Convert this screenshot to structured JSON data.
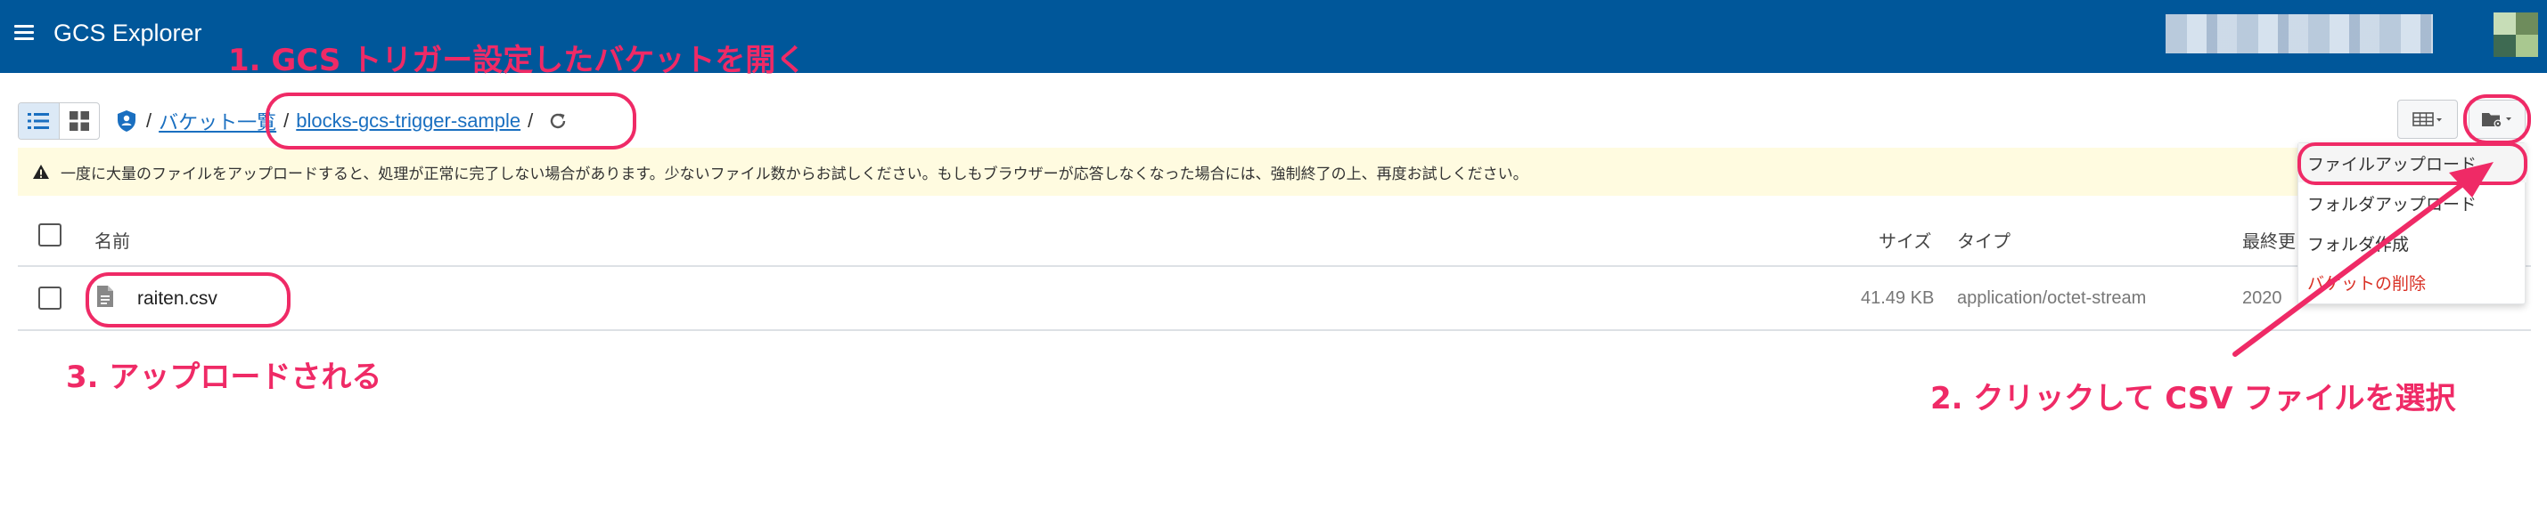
{
  "header": {
    "app_title": "GCS Explorer"
  },
  "breadcrumb": {
    "sep1": "/",
    "bucket_list": "バケット一覧",
    "sep2": "/",
    "bucket": "blocks-gcs-trigger-sample",
    "sep3": "/"
  },
  "warning": {
    "text": "一度に大量のファイルをアップロードすると、処理が正常に完了しない場合があります。少ないファイル数からお試しください。もしもブラウザーが応答しなくなった場合には、強制終了の上、再度お試しください。"
  },
  "table": {
    "columns": {
      "name": "名前",
      "size": "サイズ",
      "type": "タイプ",
      "modified": "最終更"
    },
    "rows": [
      {
        "name": "raiten.csv",
        "size": "41.49 KB",
        "type": "application/octet-stream",
        "modified": "2020"
      }
    ]
  },
  "menu": {
    "items": [
      "ファイルアップロード",
      "フォルダアップロード",
      "フォルダ作成",
      "バケットの削除"
    ]
  },
  "annotations": {
    "step1": "1. GCS トリガー設定したバケットを開く",
    "step2": "2. クリックして CSV ファイルを選択",
    "step3": "3. アップロードされる"
  },
  "colors": {
    "header": "#00579a",
    "annotation": "#ef2a66",
    "link": "#1a6fc0",
    "warning_bg": "#fffbe0",
    "danger": "#d93025"
  },
  "icons": [
    "hamburger-icon",
    "list-view-icon",
    "grid-view-icon",
    "shield-icon",
    "refresh-icon",
    "warning-icon",
    "file-icon",
    "table-columns-icon",
    "folder-settings-icon"
  ]
}
